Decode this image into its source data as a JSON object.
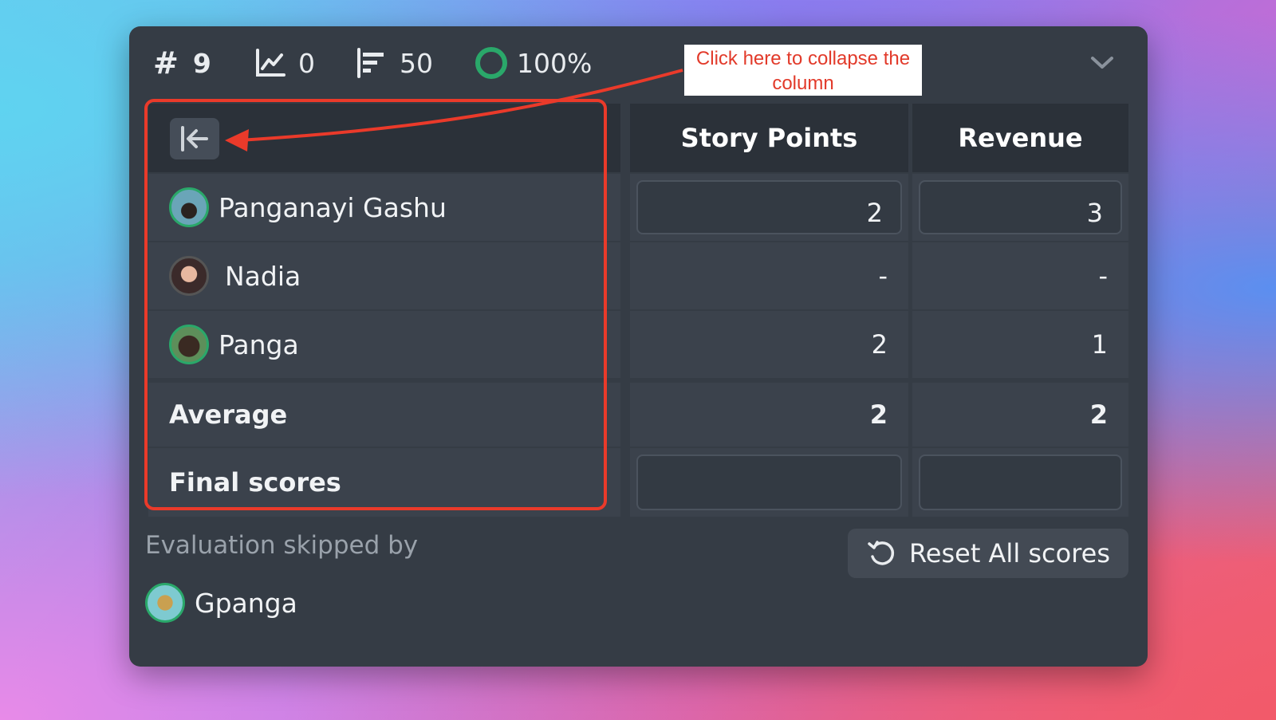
{
  "stats": {
    "ticket_number": "9",
    "chart_count": "0",
    "bars_count": "50",
    "progress_percent": "100%"
  },
  "columns": [
    "Story Points",
    "Revenue"
  ],
  "rows": [
    {
      "name": "Panganayi Gashu",
      "story_points": "2",
      "revenue": "3",
      "editable": true
    },
    {
      "name": "Nadia",
      "story_points": "-",
      "revenue": "-",
      "editable": false
    },
    {
      "name": "Panga",
      "story_points": "2",
      "revenue": "1",
      "editable": false
    }
  ],
  "average": {
    "label": "Average",
    "story_points": "2",
    "revenue": "2"
  },
  "final_scores": {
    "label": "Final scores",
    "story_points": "",
    "revenue": ""
  },
  "skipped": {
    "label": "Evaluation skipped by",
    "user": "Gpanga"
  },
  "reset_label": "Reset All scores",
  "annotation": {
    "line1": "Click here to collapse the",
    "line2": "column"
  },
  "colors": {
    "panel": "#353c45",
    "header": "#2b3139",
    "accent_green": "#2aa86a",
    "annotation_red": "#ea3a2a"
  }
}
